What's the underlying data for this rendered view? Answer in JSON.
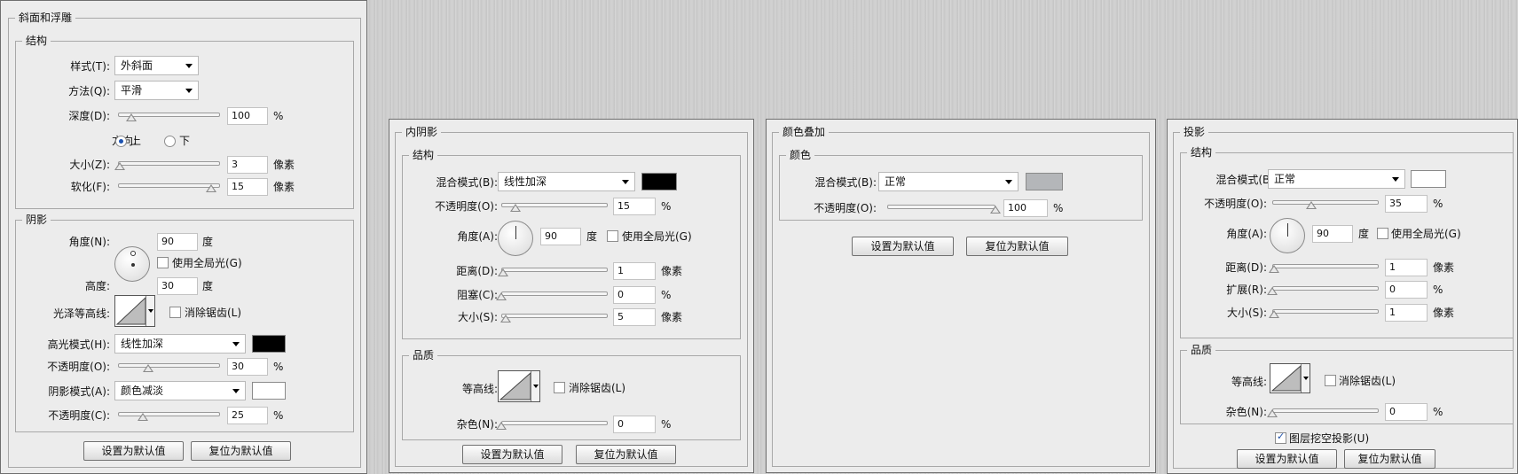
{
  "bevel": {
    "title": "斜面和浮雕",
    "structure": {
      "title": "结构",
      "style_label": "样式(T):",
      "style_value": "外斜面",
      "technique_label": "方法(Q):",
      "technique_value": "平滑",
      "depth_label": "深度(D):",
      "depth_value": "100",
      "depth_unit": "%",
      "direction_label": "方向:",
      "direction_up": "上",
      "direction_down": "下",
      "size_label": "大小(Z):",
      "size_value": "3",
      "size_unit": "像素",
      "soften_label": "软化(F):",
      "soften_value": "15",
      "soften_unit": "像素"
    },
    "shading": {
      "title": "阴影",
      "angle_label": "角度(N):",
      "angle_value": "90",
      "angle_unit": "度",
      "global_light": "使用全局光(G)",
      "altitude_label": "高度:",
      "altitude_value": "30",
      "altitude_unit": "度",
      "gloss_label": "光泽等高线:",
      "antialias": "消除锯齿(L)",
      "highlight_label": "高光模式(H):",
      "highlight_value": "线性加深",
      "highlight_color": "#000000",
      "hl_opacity_label": "不透明度(O):",
      "hl_opacity_value": "30",
      "hl_opacity_unit": "%",
      "shadow_label": "阴影模式(A):",
      "shadow_value": "颜色减淡",
      "shadow_color": "#ffffff",
      "sh_opacity_label": "不透明度(C):",
      "sh_opacity_value": "25",
      "sh_opacity_unit": "%"
    },
    "btn_default": "设置为默认值",
    "btn_reset": "复位为默认值"
  },
  "inner_shadow": {
    "title": "内阴影",
    "structure_title": "结构",
    "blend_label": "混合模式(B):",
    "blend_value": "线性加深",
    "blend_color": "#000000",
    "opacity_label": "不透明度(O):",
    "opacity_value": "15",
    "opacity_unit": "%",
    "angle_label": "角度(A):",
    "angle_value": "90",
    "angle_unit": "度",
    "global_light": "使用全局光(G)",
    "distance_label": "距离(D):",
    "distance_value": "1",
    "distance_unit": "像素",
    "choke_label": "阻塞(C):",
    "choke_value": "0",
    "choke_unit": "%",
    "size_label": "大小(S):",
    "size_value": "5",
    "size_unit": "像素",
    "quality_title": "品质",
    "contour_label": "等高线:",
    "antialias": "消除锯齿(L)",
    "noise_label": "杂色(N):",
    "noise_value": "0",
    "noise_unit": "%",
    "btn_default": "设置为默认值",
    "btn_reset": "复位为默认值"
  },
  "color_overlay": {
    "title": "颜色叠加",
    "color_title": "颜色",
    "blend_label": "混合模式(B):",
    "blend_value": "正常",
    "blend_color": "#b4b6b9",
    "opacity_label": "不透明度(O):",
    "opacity_value": "100",
    "opacity_unit": "%",
    "btn_default": "设置为默认值",
    "btn_reset": "复位为默认值"
  },
  "drop_shadow": {
    "title": "投影",
    "structure_title": "结构",
    "blend_label": "混合模式(B):",
    "blend_value": "正常",
    "blend_color": "#ffffff",
    "opacity_label": "不透明度(O):",
    "opacity_value": "35",
    "opacity_unit": "%",
    "angle_label": "角度(A):",
    "angle_value": "90",
    "angle_unit": "度",
    "global_light": "使用全局光(G)",
    "distance_label": "距离(D):",
    "distance_value": "1",
    "distance_unit": "像素",
    "spread_label": "扩展(R):",
    "spread_value": "0",
    "spread_unit": "%",
    "size_label": "大小(S):",
    "size_value": "1",
    "size_unit": "像素",
    "quality_title": "品质",
    "contour_label": "等高线:",
    "antialias": "消除锯齿(L)",
    "noise_label": "杂色(N):",
    "noise_value": "0",
    "noise_unit": "%",
    "knockout": "图层挖空投影(U)",
    "btn_default": "设置为默认值",
    "btn_reset": "复位为默认值"
  }
}
